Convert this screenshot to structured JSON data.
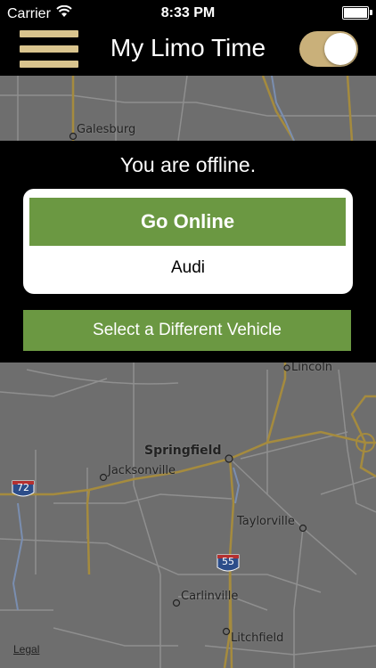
{
  "status_bar": {
    "carrier": "Carrier",
    "time": "8:33 PM"
  },
  "nav": {
    "title": "My Limo Time",
    "menu_icon": "hamburger-menu-icon",
    "toggle_state": "on",
    "accent_color": "#d9c48e"
  },
  "offline": {
    "message": "You are offline.",
    "go_online_label": "Go Online",
    "vehicle_name": "Audi",
    "select_vehicle_label": "Select a Different Vehicle",
    "button_color": "#6b9842"
  },
  "map": {
    "labels": {
      "galesburg": "Galesburg",
      "lincoln": "Lincoln",
      "springfield": "Springfield",
      "jacksonville": "Jacksonville",
      "taylorville": "Taylorville",
      "carlinville": "Carlinville",
      "litchfield": "Litchfield"
    },
    "shields": {
      "i72": "72",
      "i55": "55"
    },
    "legal": "Legal"
  }
}
